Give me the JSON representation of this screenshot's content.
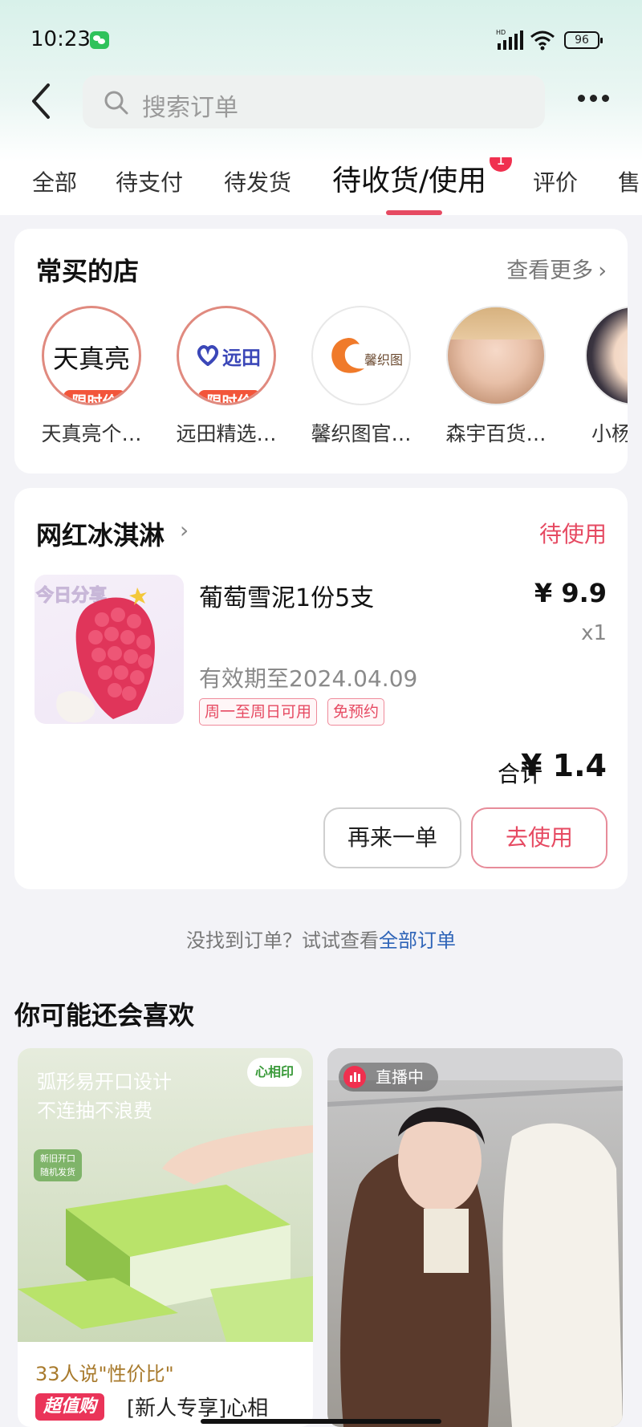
{
  "status_bar": {
    "time": "10:23",
    "battery": "96"
  },
  "header": {
    "search_placeholder": "搜索订单"
  },
  "tabs": [
    {
      "label": "全部"
    },
    {
      "label": "待支付"
    },
    {
      "label": "待发货"
    },
    {
      "label": "待收货/使用",
      "badge": "1"
    },
    {
      "label": "评价"
    },
    {
      "label": "售"
    }
  ],
  "frequent_stores": {
    "title": "常买的店",
    "see_more": "查看更多",
    "stores": [
      {
        "logo_text": "天真亮",
        "name": "天真亮个…",
        "promo": "限时价"
      },
      {
        "logo_text": "远田",
        "name": "远田精选…",
        "promo": "限时价"
      },
      {
        "logo_text": "馨织图",
        "name": "馨织图官…"
      },
      {
        "name": "森宇百货…"
      },
      {
        "name": "小杨"
      }
    ]
  },
  "order": {
    "shop_name": "网红冰淇淋",
    "status": "待使用",
    "product_image_text": "今日分享",
    "product_name": "葡萄雪泥1份5支",
    "price": "¥ 9.9",
    "quantity": "x1",
    "validity": "有效期至2024.04.09",
    "tags": [
      "周一至周日可用",
      "免预约"
    ],
    "total_label": "合计",
    "total_amount": "¥ 1.4",
    "reorder_button": "再来一单",
    "use_button": "去使用"
  },
  "not_found": {
    "text": "没找到订单？试试查看",
    "link": "全部订单"
  },
  "recommendations": {
    "title": "你可能还会喜欢",
    "items": [
      {
        "headline_line1": "弧形易开口设计",
        "headline_line2": "不连抽不浪费",
        "brand": "心相印",
        "small_tag_line1": "新旧开口",
        "small_tag_line2": "随机发货",
        "review": "33人说\"性价比\"",
        "badge": "超值购",
        "name": "[新人专享]心相"
      },
      {
        "live_label": "直播中"
      }
    ]
  },
  "colors": {
    "accent": "#e64a62",
    "link": "#2e64b8",
    "badge": "#f0304f",
    "promo": "#f2553a"
  }
}
